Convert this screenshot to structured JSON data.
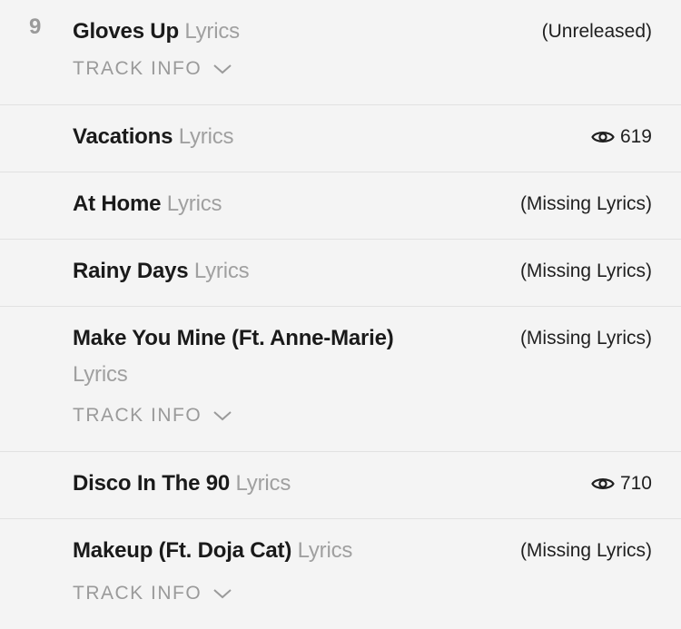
{
  "tracks": [
    {
      "number": "9",
      "name": "Gloves Up",
      "lyrics_suffix": "Lyrics",
      "meta": "(Unreleased)",
      "track_info": "TRACK INFO"
    },
    {
      "name": "Vacations",
      "lyrics_suffix": "Lyrics",
      "views": "619"
    },
    {
      "name": "At Home",
      "lyrics_suffix": "Lyrics",
      "meta": "(Missing Lyrics)"
    },
    {
      "name": "Rainy Days",
      "lyrics_suffix": "Lyrics",
      "meta": "(Missing Lyrics)"
    },
    {
      "name": "Make You Mine (Ft. Anne-Marie)",
      "lyrics_suffix": "Lyrics",
      "meta": "(Missing Lyrics)",
      "track_info": "TRACK INFO"
    },
    {
      "name": "Disco In The 90",
      "lyrics_suffix": "Lyrics",
      "views": "710"
    },
    {
      "name": "Makeup (Ft. Doja Cat)",
      "lyrics_suffix": "Lyrics",
      "meta": "(Missing Lyrics)",
      "track_info": "TRACK INFO"
    }
  ],
  "icons": {
    "views": "eye-icon",
    "expand": "chevron-down-icon"
  },
  "colors": {
    "background": "#f4f4f4",
    "muted": "#9a9a9a",
    "divider": "#e1e1e1",
    "text": "#1a1a1a"
  }
}
